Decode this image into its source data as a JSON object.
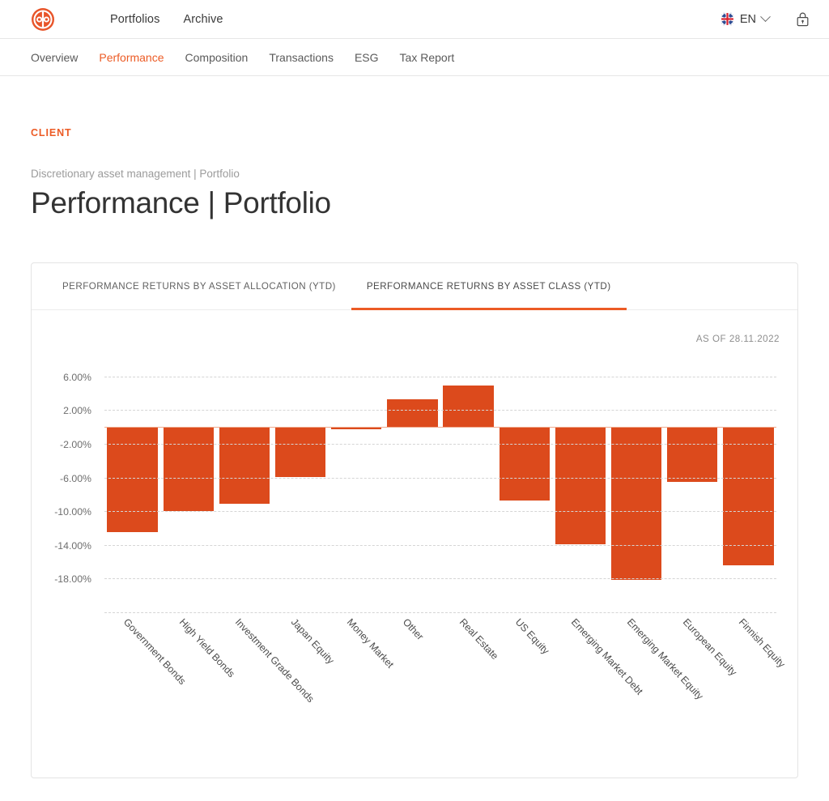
{
  "header": {
    "logo_icon": "op-logo-icon",
    "nav": [
      {
        "label": "Portfolios"
      },
      {
        "label": "Archive"
      }
    ],
    "language": {
      "flag_icon": "uk-flag-icon",
      "label": "EN",
      "chevron_icon": "chevron-down-icon"
    },
    "lock_icon": "lock-icon"
  },
  "subnav": {
    "items": [
      {
        "label": "Overview",
        "active": false
      },
      {
        "label": "Performance",
        "active": true
      },
      {
        "label": "Composition",
        "active": false
      },
      {
        "label": "Transactions",
        "active": false
      },
      {
        "label": "ESG",
        "active": false
      },
      {
        "label": "Tax Report",
        "active": false
      }
    ]
  },
  "page": {
    "client_label": "CLIENT",
    "breadcrumb": "Discretionary asset management | Portfolio",
    "title": "Performance | Portfolio"
  },
  "card": {
    "tabs": [
      {
        "label": "PERFORMANCE RETURNS BY ASSET ALLOCATION (YTD)",
        "active": false
      },
      {
        "label": "PERFORMANCE RETURNS BY ASSET CLASS (YTD)",
        "active": true
      }
    ],
    "as_of": "AS OF 28.11.2022"
  },
  "colors": {
    "brand_orange": "#ec5b25",
    "bar_orange": "#dc4a1c",
    "grid_grey": "#d5d5d5",
    "text_grey": "#6e6e6e"
  },
  "chart_data": {
    "type": "bar",
    "title": "PERFORMANCE RETURNS BY ASSET CLASS (YTD)",
    "subtitle": "AS OF 28.11.2022",
    "xlabel": "",
    "ylabel": "",
    "ylim": [
      -22.0,
      8.0
    ],
    "grid": true,
    "legend": "none",
    "ytick_values": [
      6.0,
      2.0,
      -2.0,
      -6.0,
      -10.0,
      -14.0,
      -18.0
    ],
    "ytick_labels": [
      "6.00%",
      "2.00%",
      "-2.00%",
      "-6.00%",
      "-10.00%",
      "-14.00%",
      "-18.00%"
    ],
    "categories": [
      "Government Bonds",
      "High Yield Bonds",
      "Investment Grade Bonds",
      "Japan Equity",
      "Money Market",
      "Other",
      "Real Estate",
      "US Equity",
      "Emerging Market Debt",
      "Emerging Market Equity",
      "European Equity",
      "Finnish Equity"
    ],
    "values": [
      -12.5,
      -10.0,
      -9.1,
      -5.9,
      -0.3,
      3.3,
      4.9,
      -8.7,
      -13.9,
      -18.2,
      -6.5,
      -16.4
    ],
    "bar_color": "#dc4a1c"
  }
}
